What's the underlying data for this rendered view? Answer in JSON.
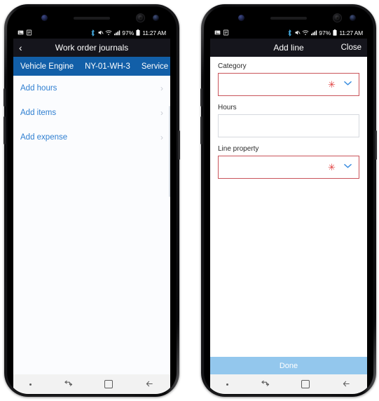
{
  "status_bar": {
    "left_icons": [
      "image-icon",
      "document-icon"
    ],
    "right_icons": [
      "bluetooth-icon",
      "mute-icon",
      "wifi-icon",
      "signal-icon"
    ],
    "battery_percent": "97%",
    "battery_icon": "battery-icon",
    "time": "11:27 AM"
  },
  "left_phone": {
    "header": {
      "back_icon": "‹",
      "title": "Work order journals"
    },
    "record_bar": {
      "name": "Vehicle Engine",
      "id": "NY-01-WH-3",
      "type": "Service"
    },
    "list_items": [
      {
        "label": "Add hours",
        "chevron": "›"
      },
      {
        "label": "Add items",
        "chevron": "›"
      },
      {
        "label": "Add expense",
        "chevron": "›"
      }
    ]
  },
  "right_phone": {
    "header": {
      "title": "Add line",
      "close_label": "Close"
    },
    "fields": [
      {
        "label": "Category",
        "value": "",
        "required": true,
        "required_marker": "✳",
        "dropdown_icon": "⌄",
        "type": "lookup"
      },
      {
        "label": "Hours",
        "value": "",
        "required": false,
        "type": "text"
      },
      {
        "label": "Line property",
        "value": "",
        "required": true,
        "required_marker": "✳",
        "dropdown_icon": "⌄",
        "type": "lookup"
      }
    ],
    "done_button": "Done"
  },
  "nav_bar": {
    "dot": "•",
    "recents_icon": "⇄",
    "home_icon": "home-square",
    "back_icon": "←"
  },
  "colors": {
    "accent_blue": "#125fa8",
    "link_blue": "#2f7fd1",
    "required_red": "#c9545a",
    "star_red": "#e0403f",
    "done_blue": "#93c7ed",
    "header_dark": "#15151c"
  }
}
